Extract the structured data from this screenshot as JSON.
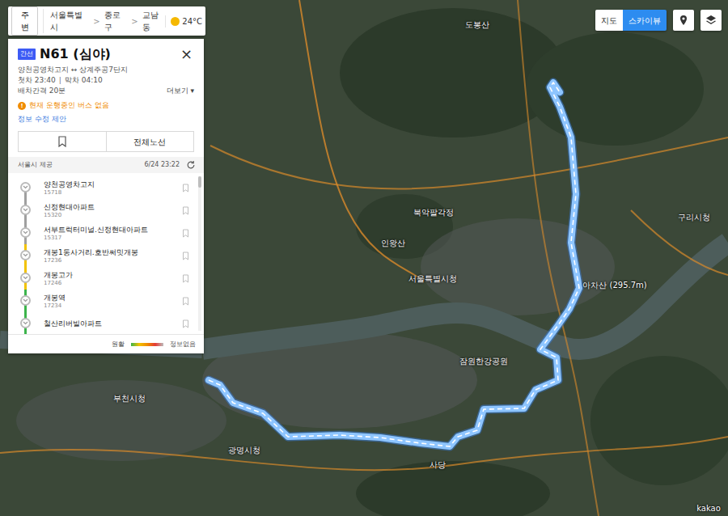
{
  "topbar": {
    "nearby": "주변",
    "breadcrumb": [
      "서울특별시",
      "종로구",
      "교남동"
    ],
    "separator": ">",
    "weather": "24°C"
  },
  "map_controls": {
    "views": [
      {
        "label": "지도",
        "selected": false
      },
      {
        "label": "스카이뷰",
        "selected": true
      }
    ]
  },
  "bus": {
    "type": "간선",
    "name": "N61 (심야)",
    "close": "×",
    "route": "양천공영차고지 ↔ 상계주공7단지",
    "first": "첫차 23:40",
    "divider": "|",
    "last": "막차 04:10",
    "interval": "배차간격 20분",
    "more": "더보기 ▾",
    "notice_icon": "!",
    "notice": "현재 운행중인 버스 없음",
    "suggest": "정보 수정 제안",
    "full_route": "전체노선"
  },
  "provider": {
    "label": "서울시 제공",
    "time": "6/24 23:22"
  },
  "stops": [
    {
      "name": "양천공영차고지",
      "id": "15718",
      "color": "#a0a0a0"
    },
    {
      "name": "신정현대아파트",
      "id": "15320",
      "color": "#a0a0a0"
    },
    {
      "name": "서부트럭터미널.신정현대아파트",
      "id": "15317",
      "color": "#a0a0a0"
    },
    {
      "name": "개봉1동사거리.호반써밋개봉",
      "id": "17236",
      "color": "#f2c200"
    },
    {
      "name": "개봉고가",
      "id": "17246",
      "color": "#f2c200"
    },
    {
      "name": "개봉역",
      "id": "17234",
      "color": "#3cb44b"
    },
    {
      "name": "철산리버빌아파트",
      "color": "#3cb44b"
    }
  ],
  "legend": {
    "smooth": "원활",
    "none": "정보없음"
  },
  "map": {
    "labels": [
      "서울특별시청",
      "구리시청",
      "광명시청",
      "부천시청",
      "아차산 (295.7m)",
      "잠원한강공원",
      "도봉산",
      "북악팔각정",
      "인왕산",
      "사당"
    ],
    "copyright": "kakao"
  }
}
